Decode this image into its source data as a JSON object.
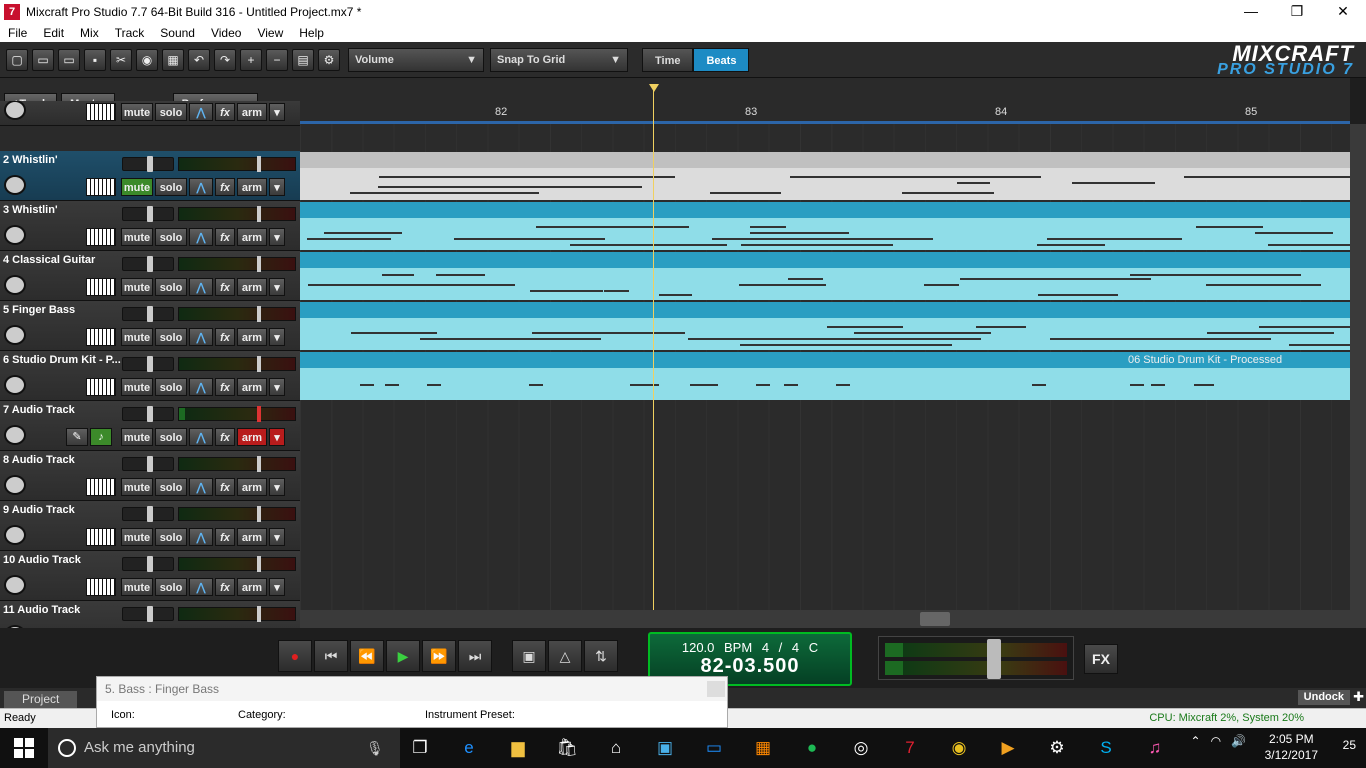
{
  "window": {
    "title": "Mixcraft Pro Studio 7.7 64-Bit Build 316 - Untitled Project.mx7 *",
    "app_icon": "7",
    "controls": [
      "—",
      "❐",
      "✕"
    ]
  },
  "menu": [
    "File",
    "Edit",
    "Mix",
    "Track",
    "Sound",
    "Video",
    "View",
    "Help"
  ],
  "toolbar": {
    "param_dropdown": "Volume",
    "snap_dropdown": "Snap To Grid",
    "time_label": "Time",
    "beats_label": "Beats",
    "active_mode": "Beats"
  },
  "logo": {
    "line1": "MIXCRAFT",
    "line2": "PRO STUDIO",
    "version": "7"
  },
  "left_header": {
    "add_track": "+Track",
    "master": "Master",
    "performance": "Performance"
  },
  "ruler": {
    "bars": [
      "82",
      "83",
      "84",
      "85"
    ]
  },
  "tracks": [
    {
      "name": "",
      "icon": "keyboard-icon",
      "muted": false,
      "armed": false
    },
    {
      "name": "2 Whistlin'",
      "icon": "whistle-icon",
      "muted": true,
      "armed": false,
      "selected": true
    },
    {
      "name": "3 Whistlin'",
      "icon": "whistle-icon",
      "muted": false,
      "armed": false
    },
    {
      "name": "4 Classical Guitar",
      "icon": "guitar-icon",
      "muted": false,
      "armed": false
    },
    {
      "name": "5 Finger Bass",
      "icon": "bass-guitar-icon",
      "muted": false,
      "armed": false
    },
    {
      "name": "6 Studio Drum Kit - P...",
      "icon": "drum-kit-icon",
      "muted": false,
      "armed": false
    },
    {
      "name": "7 Audio Track",
      "icon": "audio-icon",
      "muted": false,
      "armed": true
    },
    {
      "name": "8 Audio Track",
      "icon": "audio-icon",
      "muted": false,
      "armed": false
    },
    {
      "name": "9 Audio Track",
      "icon": "audio-icon",
      "muted": false,
      "armed": false
    },
    {
      "name": "10 Audio Track",
      "icon": "audio-icon",
      "muted": false,
      "armed": false
    },
    {
      "name": "11 Audio Track",
      "icon": "audio-icon",
      "muted": false,
      "armed": false
    }
  ],
  "track_buttons": {
    "mute": "mute",
    "solo": "solo",
    "fx": "fx",
    "arm": "arm"
  },
  "clips": {
    "drum_clip_name": "06 Studio Drum Kit - Processed"
  },
  "transport": {
    "bpm": "120.0 BPM",
    "time_sig": "4 / 4",
    "key": "C",
    "position": "82-03.500",
    "fx_label": "FX"
  },
  "bottom": {
    "project_tab": "Project",
    "undock": "Undock",
    "status": "Ready",
    "cpu": "CPU: Mixcraft 2%, System 20%"
  },
  "popup": {
    "title": "5. Bass : Finger Bass",
    "icon_label": "Icon:",
    "category_label": "Category:",
    "preset_label": "Instrument Preset:"
  },
  "taskbar": {
    "search_placeholder": "Ask me anything",
    "time": "2:05 PM",
    "date": "3/12/2017",
    "notifications": "25"
  },
  "colors": {
    "accent": "#1d8bc4",
    "mute_on": "#3c8a2a",
    "arm_on": "#b81c1c",
    "clip_cyan": "#8fdde8",
    "playhead": "#f0d060"
  }
}
